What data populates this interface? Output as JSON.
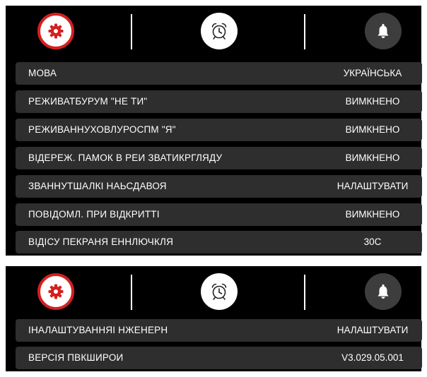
{
  "tabs": [
    {
      "name": "settings",
      "icon": "gear-icon",
      "active": true
    },
    {
      "name": "alarm",
      "icon": "alarm-clock-icon",
      "active": false
    },
    {
      "name": "notifications",
      "icon": "bell-icon",
      "active": false
    }
  ],
  "colors": {
    "accent": "#d42020",
    "row_bg": "#2e2e2e",
    "panel_bg": "#000000"
  },
  "page1": {
    "rows": [
      {
        "label": "МОВА",
        "value": "УКРАЇНСЬКА"
      },
      {
        "label": "РЕЖИВАТБУРУМ \"НЕ ТИ\"",
        "value": "ВИМКНЕНО"
      },
      {
        "label": "РЕЖИВАННУХОВЛУРОСПМ \"Я\"",
        "value": "ВИМКНЕНО"
      },
      {
        "label": "ВІДЕРЕЖ. ПАМОК В РЕИ ЗВАТИКРГЛЯДУ",
        "value": "ВИМКНЕНО"
      },
      {
        "label": "ЗВАННУТШАЛКІ НАЬСДАВОЯ",
        "value": "НАЛАШТУВАТИ"
      },
      {
        "label": "ПОВІДОМЛ. ПРИ ВІДКРИТТІ",
        "value": "ВИМКНЕНО"
      },
      {
        "label": "ВІДІСУ ПЕКРАНЯ ЕННЛЮЧКЛЯ",
        "value": "30С"
      }
    ]
  },
  "page2": {
    "rows": [
      {
        "label": "ІНАЛАШТУВАННЯІ НЖЕНЕРН",
        "value": "НАЛАШТУВАТИ"
      },
      {
        "label": "ВЕРСІЯ ПВКШИРОИ",
        "value": "V3.029.05.001"
      }
    ]
  }
}
